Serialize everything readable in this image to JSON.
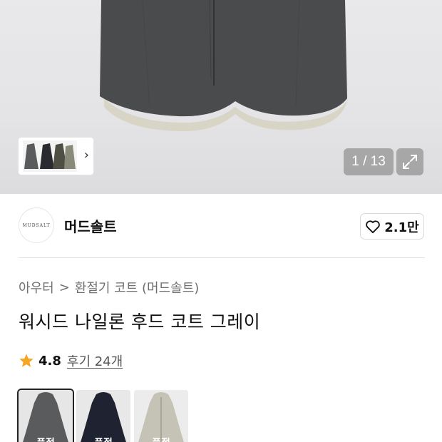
{
  "gallery": {
    "counter": "1 / 13",
    "thumb_chevron": "›",
    "expand_icon": "expand-icon"
  },
  "brand": {
    "logo_text": "MUDSALT",
    "name": "머드솔트",
    "like_count": "2.1만"
  },
  "breadcrumb": {
    "items": [
      "아우터",
      "환절기 코트 (머드솔트)"
    ],
    "separator": ">"
  },
  "product": {
    "title": "워시드 나일론 후드 코트 그레이",
    "rating": "4.8",
    "reviews": "후기 24개"
  },
  "variants": [
    {
      "tag": "품절",
      "color": "#5a5b5c",
      "selected": true
    },
    {
      "tag": "품절",
      "color": "#1f2230",
      "selected": false
    },
    {
      "tag": "품절",
      "color": "#c4c3b6",
      "selected": false
    }
  ],
  "colors": {
    "coat": "#4a4b4d",
    "lining": "#d8d4c6",
    "star": "#f5a623"
  }
}
